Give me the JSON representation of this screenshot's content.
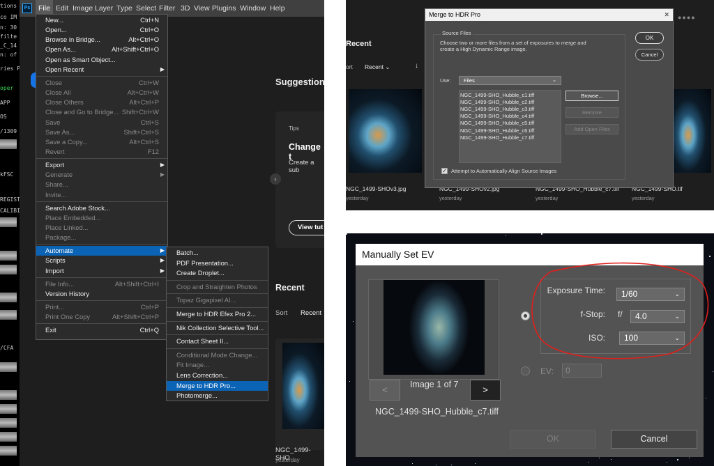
{
  "terminal": {
    "lines": [
      "tions -",
      "co IM",
      "n: 30",
      "filte",
      "_C_14",
      "n: of",
      "ries Pr",
      "oper",
      "APP",
      "OS",
      "/1309",
      "kFSC",
      "REGIST",
      "CALIBI",
      "/CFA"
    ]
  },
  "menubar": {
    "logo": "Ps",
    "items": [
      "File",
      "Edit",
      "Image",
      "Layer",
      "Type",
      "Select",
      "Filter",
      "3D",
      "View",
      "Plugins",
      "Window",
      "Help"
    ]
  },
  "home": {
    "suggestions": "Suggestions",
    "tips": "Tips",
    "tip_title": "Change t",
    "tip_text": "Create a sub",
    "view_button": "View tut",
    "recent_heading": "Recent",
    "sort": "Sort",
    "recent_sort": "Recent",
    "file_name": "NGC_1499-SHO",
    "file_date": "yesterday"
  },
  "file_menu": [
    {
      "label": "New...",
      "shortcut": "Ctrl+N",
      "enabled": true
    },
    {
      "label": "Open...",
      "shortcut": "Ctrl+O",
      "enabled": true
    },
    {
      "label": "Browse in Bridge...",
      "shortcut": "Alt+Ctrl+O",
      "enabled": true
    },
    {
      "label": "Open As...",
      "shortcut": "Alt+Shift+Ctrl+O",
      "enabled": true
    },
    {
      "label": "Open as Smart Object...",
      "shortcut": "",
      "enabled": true
    },
    {
      "label": "Open Recent",
      "shortcut": "",
      "enabled": true,
      "submenu": true
    },
    {
      "sep": true
    },
    {
      "label": "Close",
      "shortcut": "Ctrl+W",
      "enabled": false
    },
    {
      "label": "Close All",
      "shortcut": "Alt+Ctrl+W",
      "enabled": false
    },
    {
      "label": "Close Others",
      "shortcut": "Alt+Ctrl+P",
      "enabled": false
    },
    {
      "label": "Close and Go to Bridge...",
      "shortcut": "Shift+Ctrl+W",
      "enabled": false
    },
    {
      "label": "Save",
      "shortcut": "Ctrl+S",
      "enabled": false
    },
    {
      "label": "Save As...",
      "shortcut": "Shift+Ctrl+S",
      "enabled": false
    },
    {
      "label": "Save a Copy...",
      "shortcut": "Alt+Ctrl+S",
      "enabled": false
    },
    {
      "label": "Revert",
      "shortcut": "F12",
      "enabled": false
    },
    {
      "sep": true
    },
    {
      "label": "Export",
      "shortcut": "",
      "enabled": true,
      "submenu": true
    },
    {
      "label": "Generate",
      "shortcut": "",
      "enabled": false,
      "submenu": true
    },
    {
      "label": "Share...",
      "shortcut": "",
      "enabled": false
    },
    {
      "label": "Invite...",
      "shortcut": "",
      "enabled": false
    },
    {
      "sep": true
    },
    {
      "label": "Search Adobe Stock...",
      "shortcut": "",
      "enabled": true
    },
    {
      "label": "Place Embedded...",
      "shortcut": "",
      "enabled": false
    },
    {
      "label": "Place Linked...",
      "shortcut": "",
      "enabled": false
    },
    {
      "label": "Package...",
      "shortcut": "",
      "enabled": false
    },
    {
      "sep": true
    },
    {
      "label": "Automate",
      "shortcut": "",
      "enabled": true,
      "submenu": true,
      "highlight": true
    },
    {
      "label": "Scripts",
      "shortcut": "",
      "enabled": true,
      "submenu": true
    },
    {
      "label": "Import",
      "shortcut": "",
      "enabled": true,
      "submenu": true
    },
    {
      "sep": true
    },
    {
      "label": "File Info...",
      "shortcut": "Alt+Shift+Ctrl+I",
      "enabled": false
    },
    {
      "label": "Version History",
      "shortcut": "",
      "enabled": true
    },
    {
      "sep": true
    },
    {
      "label": "Print...",
      "shortcut": "Ctrl+P",
      "enabled": false
    },
    {
      "label": "Print One Copy",
      "shortcut": "Alt+Shift+Ctrl+P",
      "enabled": false
    },
    {
      "sep": true
    },
    {
      "label": "Exit",
      "shortcut": "Ctrl+Q",
      "enabled": true
    }
  ],
  "automate_menu": [
    {
      "label": "Batch...",
      "enabled": true
    },
    {
      "label": "PDF Presentation...",
      "enabled": true
    },
    {
      "label": "Create Droplet...",
      "enabled": true
    },
    {
      "sep": true
    },
    {
      "label": "Crop and Straighten Photos",
      "enabled": false
    },
    {
      "sep": true
    },
    {
      "label": "Topaz Gigapixel AI...",
      "enabled": false
    },
    {
      "sep": true
    },
    {
      "label": "Merge to HDR Efex Pro 2...",
      "enabled": true
    },
    {
      "sep": true
    },
    {
      "label": "Nik Collection Selective Tool...",
      "enabled": true
    },
    {
      "sep": true
    },
    {
      "label": "Contact Sheet II...",
      "enabled": true
    },
    {
      "sep": true
    },
    {
      "label": "Conditional Mode Change...",
      "enabled": false
    },
    {
      "label": "Fit Image...",
      "enabled": false
    },
    {
      "label": "Lens Correction...",
      "enabled": true
    },
    {
      "label": "Merge to HDR Pro...",
      "enabled": true,
      "highlight": true
    },
    {
      "label": "Photomerge...",
      "enabled": true
    }
  ],
  "top_right": {
    "recent_heading": "Recent",
    "sort": "ort",
    "recent_sort": "Recent",
    "files": [
      {
        "name": "NGC_1499-SHOv3.jpg",
        "date": "yesterday"
      },
      {
        "name": "NGC_1499-SHOv2.jpg",
        "date": "yesterday"
      },
      {
        "name": "NGC_1499-SHO_Hubble_c7.tiff",
        "date": "yesterday"
      },
      {
        "name": "NGC_1499-SHO.tif",
        "date": "yesterday"
      }
    ]
  },
  "hdr_dialog": {
    "title": "Merge to HDR Pro",
    "group_label": "Source Files",
    "description": "Choose two or more files from a set of exposures to merge and create a High Dynamic Range image.",
    "use_label": "Use:",
    "use_value": "Files",
    "files": [
      "NGC_1499-SHO_Hubble_c1.tiff",
      "NGC_1499-SHO_Hubble_c2.tiff",
      "NGC_1499-SHO_Hubble_c3.tiff",
      "NGC_1499-SHO_Hubble_c4.tiff",
      "NGC_1499-SHO_Hubble_c5.tiff",
      "NGC_1499-SHO_Hubble_c6.tiff",
      "NGC_1499-SHO_Hubble_c7.tiff"
    ],
    "browse": "Browse...",
    "remove": "Remove",
    "add_open": "Add Open Files",
    "align_label": "Attempt to Automatically Align Source Images",
    "ok": "OK",
    "cancel": "Cancel"
  },
  "ev_dialog": {
    "title": "Manually Set EV",
    "exposure_label": "Exposure Time:",
    "exposure_value": "1/60",
    "fstop_label": "f-Stop:",
    "fstop_prefix": "f/",
    "fstop_value": "4.0",
    "iso_label": "ISO:",
    "iso_value": "100",
    "ev_label": "EV:",
    "ev_value": "0",
    "prev": "<",
    "next": ">",
    "image_counter": "Image 1 of 7",
    "filename": "NGC_1499-SHO_Hubble_c7.tiff",
    "ok": "OK",
    "cancel": "Cancel"
  },
  "colors": {
    "highlight": "#0a63b5",
    "annotation": "#e0201c"
  }
}
